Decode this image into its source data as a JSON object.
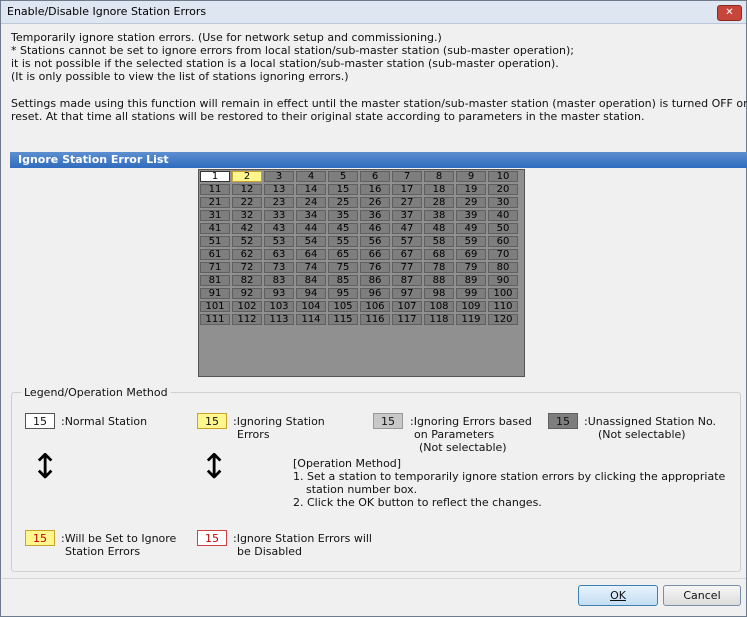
{
  "window": {
    "title": "Enable/Disable Ignore Station Errors",
    "close_glyph": "✕"
  },
  "intro": {
    "lines": [
      "Temporarily ignore station errors. (Use for network setup and commissioning.)",
      "* Stations cannot be set to ignore errors from local station/sub-master station (sub-master operation);",
      "it is not possible if the selected station is a local station/sub-master station (sub-master operation).",
      "(It is only possible to view the list of stations ignoring errors.)"
    ]
  },
  "settings_note": {
    "lines": [
      "Settings made using this function will remain in effect until the master station/sub-master station (master operation) is turned OFF or",
      "reset. At that time all stations will be restored to their original state according to parameters in the master station."
    ]
  },
  "station_list": {
    "header": "Ignore Station Error List",
    "rows": [
      [
        "1",
        "2",
        "3",
        "4",
        "5",
        "6",
        "7",
        "8",
        "9",
        "10"
      ],
      [
        "11",
        "12",
        "13",
        "14",
        "15",
        "16",
        "17",
        "18",
        "19",
        "20"
      ],
      [
        "21",
        "22",
        "23",
        "24",
        "25",
        "26",
        "27",
        "28",
        "29",
        "30"
      ],
      [
        "31",
        "32",
        "33",
        "34",
        "35",
        "36",
        "37",
        "38",
        "39",
        "40"
      ],
      [
        "41",
        "42",
        "43",
        "44",
        "45",
        "46",
        "47",
        "48",
        "49",
        "50"
      ],
      [
        "51",
        "52",
        "53",
        "54",
        "55",
        "56",
        "57",
        "58",
        "59",
        "60"
      ],
      [
        "61",
        "62",
        "63",
        "64",
        "65",
        "66",
        "67",
        "68",
        "69",
        "70"
      ],
      [
        "71",
        "72",
        "73",
        "74",
        "75",
        "76",
        "77",
        "78",
        "79",
        "80"
      ],
      [
        "81",
        "82",
        "83",
        "84",
        "85",
        "86",
        "87",
        "88",
        "89",
        "90"
      ],
      [
        "91",
        "92",
        "93",
        "94",
        "95",
        "96",
        "97",
        "98",
        "99",
        "100"
      ],
      [
        "101",
        "102",
        "103",
        "104",
        "105",
        "106",
        "107",
        "108",
        "109",
        "110"
      ],
      [
        "111",
        "112",
        "113",
        "114",
        "115",
        "116",
        "117",
        "118",
        "119",
        "120"
      ]
    ],
    "states": {
      "1": "normal",
      "2": "ignoring",
      "default": "unassigned"
    },
    "colors": {
      "normal": "#ffffff",
      "ignoring": "#fff78e",
      "unassigned": "#7e7e7e",
      "header_bar": "#3a76c4"
    }
  },
  "legend": {
    "title": "Legend/Operation Method",
    "sample_number": "15",
    "normal": {
      "text": ":Normal Station"
    },
    "ignoring": {
      "line1": ":Ignoring Station",
      "line2": "Errors"
    },
    "ignoring_params": {
      "line1": ":Ignoring Errors based",
      "line2": "on Parameters",
      "line3": "(Not selectable)"
    },
    "unassigned": {
      "line1": ":Unassigned Station No.",
      "line2": "(Not selectable)"
    },
    "will_set": {
      "line1": ":Will be Set to Ignore",
      "line2": "Station Errors"
    },
    "will_disable": {
      "line1": ":Ignore Station Errors will",
      "line2": "be Disabled"
    },
    "arrow_glyph": "↕",
    "operation_method": [
      "[Operation Method]",
      "1. Set a station to temporarily ignore station errors by clicking the appropriate",
      "station number box.",
      "2. Click the OK button to reflect the changes."
    ]
  },
  "buttons": {
    "ok": "OK",
    "cancel": "Cancel"
  }
}
